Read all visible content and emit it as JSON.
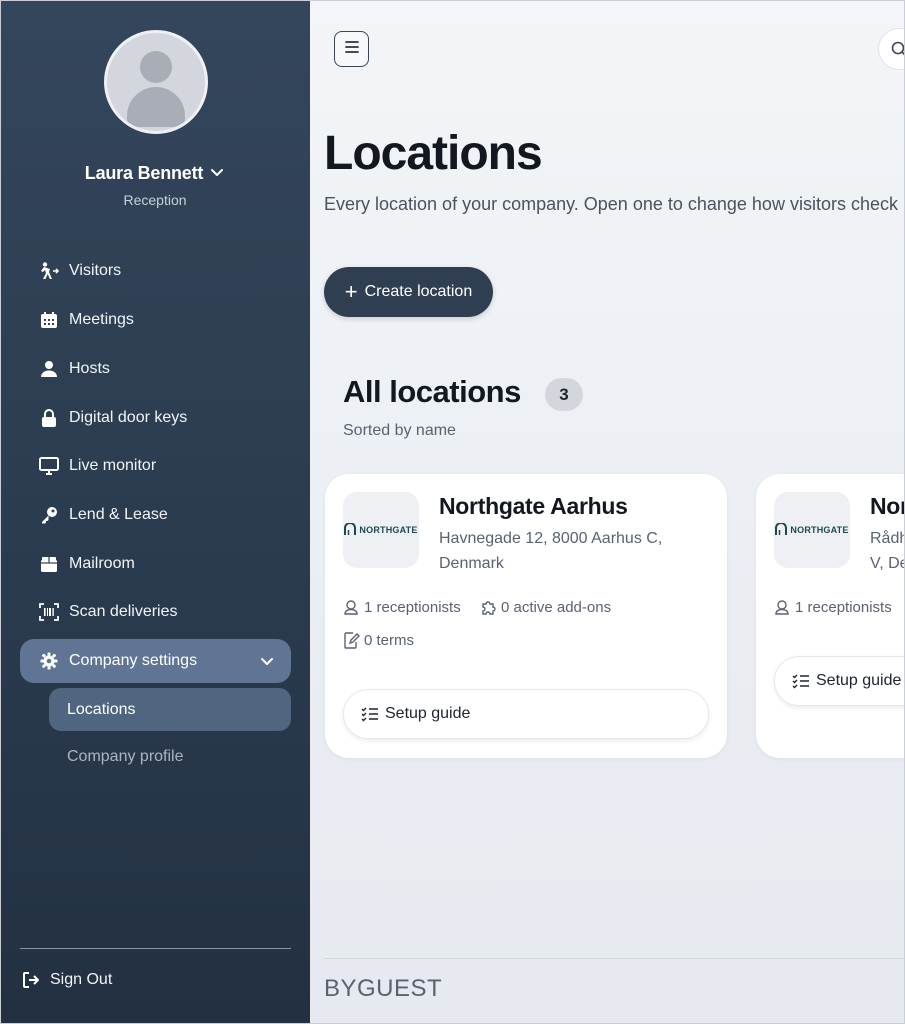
{
  "user": {
    "name": "Laura Bennett",
    "role": "Reception"
  },
  "sidebar": {
    "items": [
      {
        "label": "Visitors",
        "icon": "visitor-icon"
      },
      {
        "label": "Meetings",
        "icon": "calendar-icon"
      },
      {
        "label": "Hosts",
        "icon": "host-icon"
      },
      {
        "label": "Digital door keys",
        "icon": "lock-icon"
      },
      {
        "label": "Live monitor",
        "icon": "monitor-icon"
      },
      {
        "label": "Lend & Lease",
        "icon": "key-icon"
      },
      {
        "label": "Mailroom",
        "icon": "package-icon"
      },
      {
        "label": "Scan deliveries",
        "icon": "barcode-icon"
      }
    ],
    "company_settings": "Company settings",
    "sub_items": {
      "locations": "Locations",
      "company_profile": "Company profile"
    },
    "sign_out": "Sign Out"
  },
  "page": {
    "title": "Locations",
    "description": "Every location of your company. Open one to change how visitors check",
    "create_button": "Create location"
  },
  "section": {
    "title": "All locations",
    "count": "3",
    "sort_label": "Sorted by name"
  },
  "cards": [
    {
      "name": "Northgate Aarhus",
      "address": "Havnegade 12, 8000 Aarhus C, Denmark",
      "logo_text": "NORTHGATE",
      "receptionists": "1 receptionists",
      "addons": "0 active add-ons",
      "terms": "0 terms",
      "setup": "Setup guide"
    },
    {
      "name": "Nor",
      "address": "Rådh V, De",
      "logo_text": "NORTHGATE",
      "receptionists": "1 receptionists",
      "setup": "Setup guide"
    }
  ],
  "footer": {
    "brand": "BYGUEST"
  },
  "colors": {
    "sidebar": "#2e3f54",
    "active": "#5f7593",
    "primary_button": "#2f3e51"
  }
}
